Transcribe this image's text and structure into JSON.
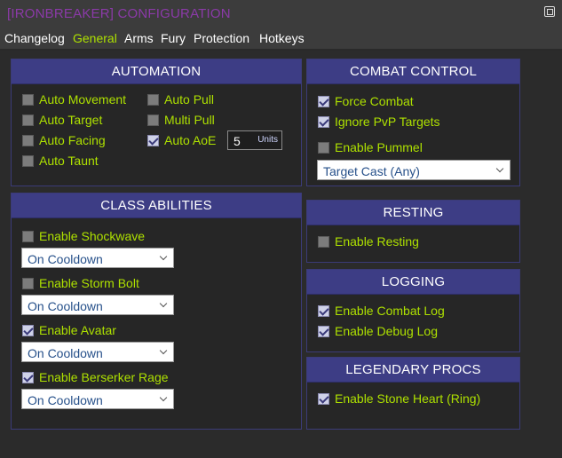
{
  "window": {
    "title": "[IRONBREAKER] CONFIGURATION"
  },
  "tabs": [
    {
      "label": "Changelog",
      "active": false
    },
    {
      "label": "General",
      "active": true
    },
    {
      "label": "Arms",
      "active": false
    },
    {
      "label": "Fury",
      "active": false
    },
    {
      "label": "Protection",
      "active": false
    },
    {
      "label": "Hotkeys",
      "active": false
    }
  ],
  "automation": {
    "title": "AUTOMATION",
    "auto_movement": {
      "label": "Auto Movement",
      "checked": false
    },
    "auto_target": {
      "label": "Auto Target",
      "checked": false
    },
    "auto_facing": {
      "label": "Auto Facing",
      "checked": false
    },
    "auto_taunt": {
      "label": "Auto Taunt",
      "checked": false
    },
    "auto_pull": {
      "label": "Auto Pull",
      "checked": false
    },
    "multi_pull": {
      "label": "Multi Pull",
      "checked": false
    },
    "auto_aoe": {
      "label": "Auto AoE",
      "checked": true
    },
    "aoe_units": {
      "value": "5",
      "unit_label": "Units"
    }
  },
  "combat_control": {
    "title": "COMBAT CONTROL",
    "force_combat": {
      "label": "Force Combat",
      "checked": true
    },
    "ignore_pvp": {
      "label": "Ignore PvP Targets",
      "checked": true
    },
    "enable_pummel": {
      "label": "Enable Pummel",
      "checked": false
    },
    "pummel_target": {
      "value": "Target Cast (Any)"
    }
  },
  "class_abilities": {
    "title": "CLASS ABILITIES",
    "shockwave": {
      "label": "Enable Shockwave",
      "checked": false,
      "mode": "On Cooldown"
    },
    "storm_bolt": {
      "label": "Enable Storm Bolt",
      "checked": false,
      "mode": "On Cooldown"
    },
    "avatar": {
      "label": "Enable Avatar",
      "checked": true,
      "mode": "On Cooldown"
    },
    "berserker_rage": {
      "label": "Enable Berserker Rage",
      "checked": true,
      "mode": "On Cooldown"
    }
  },
  "resting": {
    "title": "RESTING",
    "enable_resting": {
      "label": "Enable Resting",
      "checked": false
    }
  },
  "logging": {
    "title": "LOGGING",
    "combat_log": {
      "label": "Enable Combat Log",
      "checked": true
    },
    "debug_log": {
      "label": "Enable Debug Log",
      "checked": true
    }
  },
  "legendary_procs": {
    "title": "LEGENDARY PROCS",
    "stone_heart": {
      "label": "Enable Stone Heart (Ring)",
      "checked": true
    }
  },
  "colors": {
    "accent_green": "#aee100",
    "panel_header": "#3d3d85",
    "title_purple": "#8b3aa8"
  }
}
